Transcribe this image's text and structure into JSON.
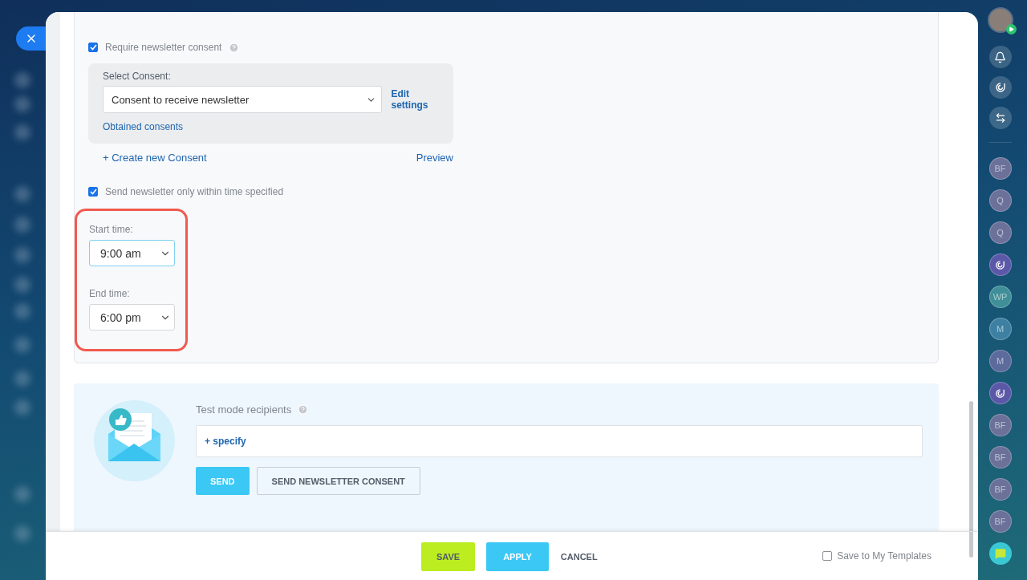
{
  "consent": {
    "require_checkbox": {
      "label": "Require newsletter consent",
      "checked": true
    },
    "select_label": "Select Consent:",
    "select_value": "Consent to receive newsletter",
    "edit_link": "Edit settings",
    "obtained_link": "Obtained consents",
    "create_link": "+ Create new Consent",
    "preview_link": "Preview"
  },
  "schedule": {
    "checkbox": {
      "label": "Send newsletter only within time specified",
      "checked": true
    },
    "start_label": "Start time:",
    "start_value": "9:00 am",
    "start_focused": true,
    "end_label": "End time:",
    "end_value": "6:00 pm",
    "end_focused": false
  },
  "test_mode": {
    "label": "Test mode recipients",
    "specify": "+ specify",
    "buttons": [
      {
        "label": "SEND",
        "kind": "primary"
      },
      {
        "label": "SEND NEWSLETTER CONSENT",
        "kind": "outline"
      }
    ]
  },
  "footer": {
    "buttons": [
      {
        "label": "SAVE",
        "kind": "save"
      },
      {
        "label": "APPLY",
        "kind": "apply"
      },
      {
        "label": "CANCEL",
        "kind": "link"
      }
    ],
    "template_checkbox": {
      "label": "Save to My Templates",
      "checked": false
    }
  },
  "right_sidebar": {
    "tools": [
      {
        "kind": "bell"
      },
      {
        "kind": "spiral"
      },
      {
        "kind": "swap"
      }
    ],
    "contacts": [
      {
        "kind": "text",
        "text": "BF",
        "color": "#6b7199"
      },
      {
        "kind": "text",
        "text": "Q",
        "color": "#6b7199"
      },
      {
        "kind": "text",
        "text": "Q",
        "color": "#6b7199"
      },
      {
        "kind": "spiral",
        "color": "#5b58a8"
      },
      {
        "kind": "text",
        "text": "WP",
        "color": "#3f8e98"
      },
      {
        "kind": "text",
        "text": "M",
        "color": "#3e80a2"
      },
      {
        "kind": "text",
        "text": "M",
        "color": "#5d6a9c"
      },
      {
        "kind": "spiral",
        "color": "#5b58a8"
      },
      {
        "kind": "text",
        "text": "BF",
        "color": "#6b7199"
      },
      {
        "kind": "text",
        "text": "BF",
        "color": "#6b7199"
      },
      {
        "kind": "text",
        "text": "BF",
        "color": "#6b7199"
      },
      {
        "kind": "text",
        "text": "BF",
        "color": "#6b7199"
      }
    ]
  }
}
